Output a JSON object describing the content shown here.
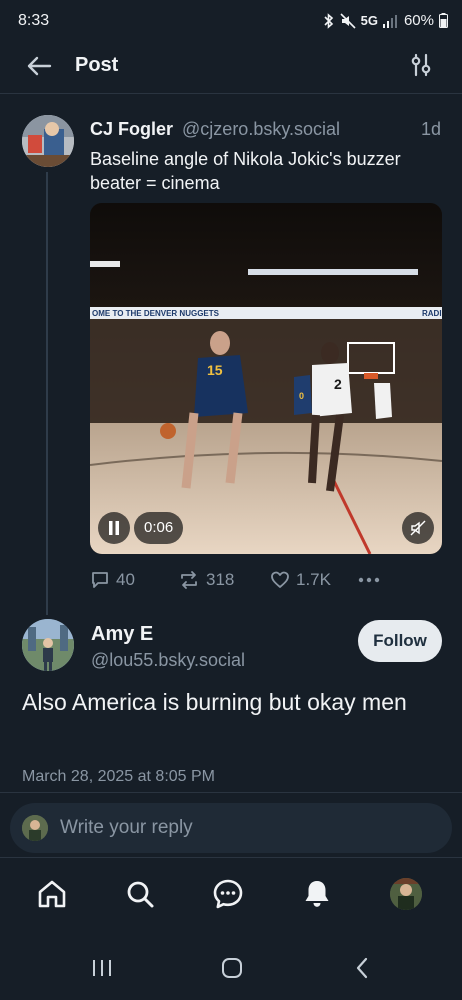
{
  "status_bar": {
    "time": "8:33",
    "network": "5G",
    "battery": "60%"
  },
  "header": {
    "title": "Post"
  },
  "parent_post": {
    "author_name": "CJ Fogler",
    "author_handle": "@cjzero.bsky.social",
    "time_ago": "1d",
    "text": "Baseline angle of Nikola Jokic's buzzer beater = cinema",
    "video": {
      "time": "0:06",
      "banner_text": "OME TO THE DENVER NUGGETS",
      "banner_right": "RADI",
      "jersey_a": "15",
      "jersey_b": "2",
      "jersey_c": "0"
    },
    "replies": "40",
    "reposts": "318",
    "likes": "1.7K"
  },
  "main_post": {
    "author_name": "Amy E",
    "author_handle": "@lou55.bsky.social",
    "follow_label": "Follow",
    "text": "Also America is burning but okay men",
    "date": "March 28, 2025 at 8:05 PM"
  },
  "reply_bar": {
    "placeholder": "Write your reply"
  },
  "colors": {
    "background": "#161e27",
    "accent": "#e7ebef",
    "muted": "#8a96a3"
  }
}
